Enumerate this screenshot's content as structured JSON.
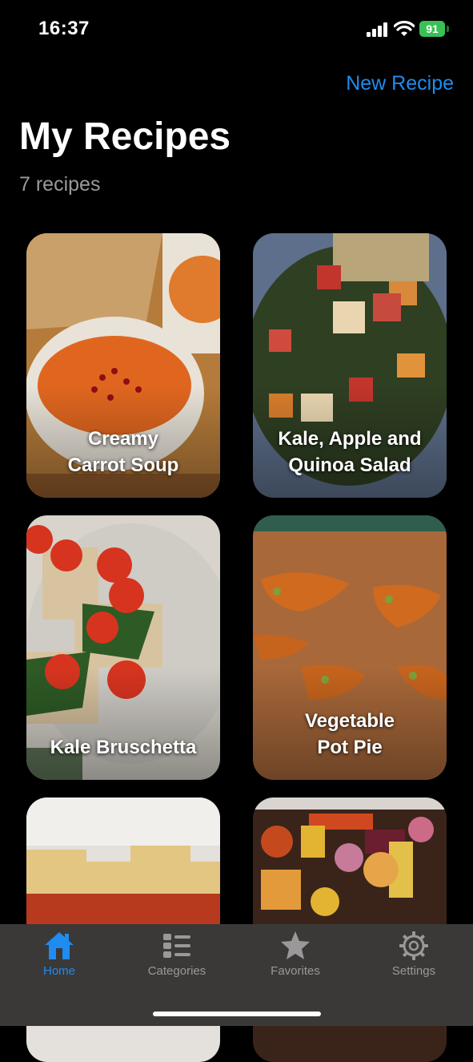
{
  "status_bar": {
    "time": "16:37",
    "battery": "91"
  },
  "header": {
    "new_recipe": "New Recipe",
    "title": "My Recipes",
    "subtitle": "7 recipes"
  },
  "recipes": [
    {
      "name": "Creamy\nCarrot Soup"
    },
    {
      "name": "Kale, Apple and\nQuinoa Salad"
    },
    {
      "name": "Kale Bruschetta"
    },
    {
      "name": "Vegetable\nPot Pie"
    },
    {
      "name": ""
    },
    {
      "name": ""
    }
  ],
  "tabs": [
    {
      "label": "Home",
      "icon": "house-icon",
      "active": true
    },
    {
      "label": "Categories",
      "icon": "list-icon",
      "active": false
    },
    {
      "label": "Favorites",
      "icon": "star-icon",
      "active": false
    },
    {
      "label": "Settings",
      "icon": "gear-icon",
      "active": false
    }
  ],
  "colors": {
    "accent": "#1e8cf0",
    "background": "#000000",
    "tab_bar": "#3b3838",
    "battery": "#39c155"
  }
}
